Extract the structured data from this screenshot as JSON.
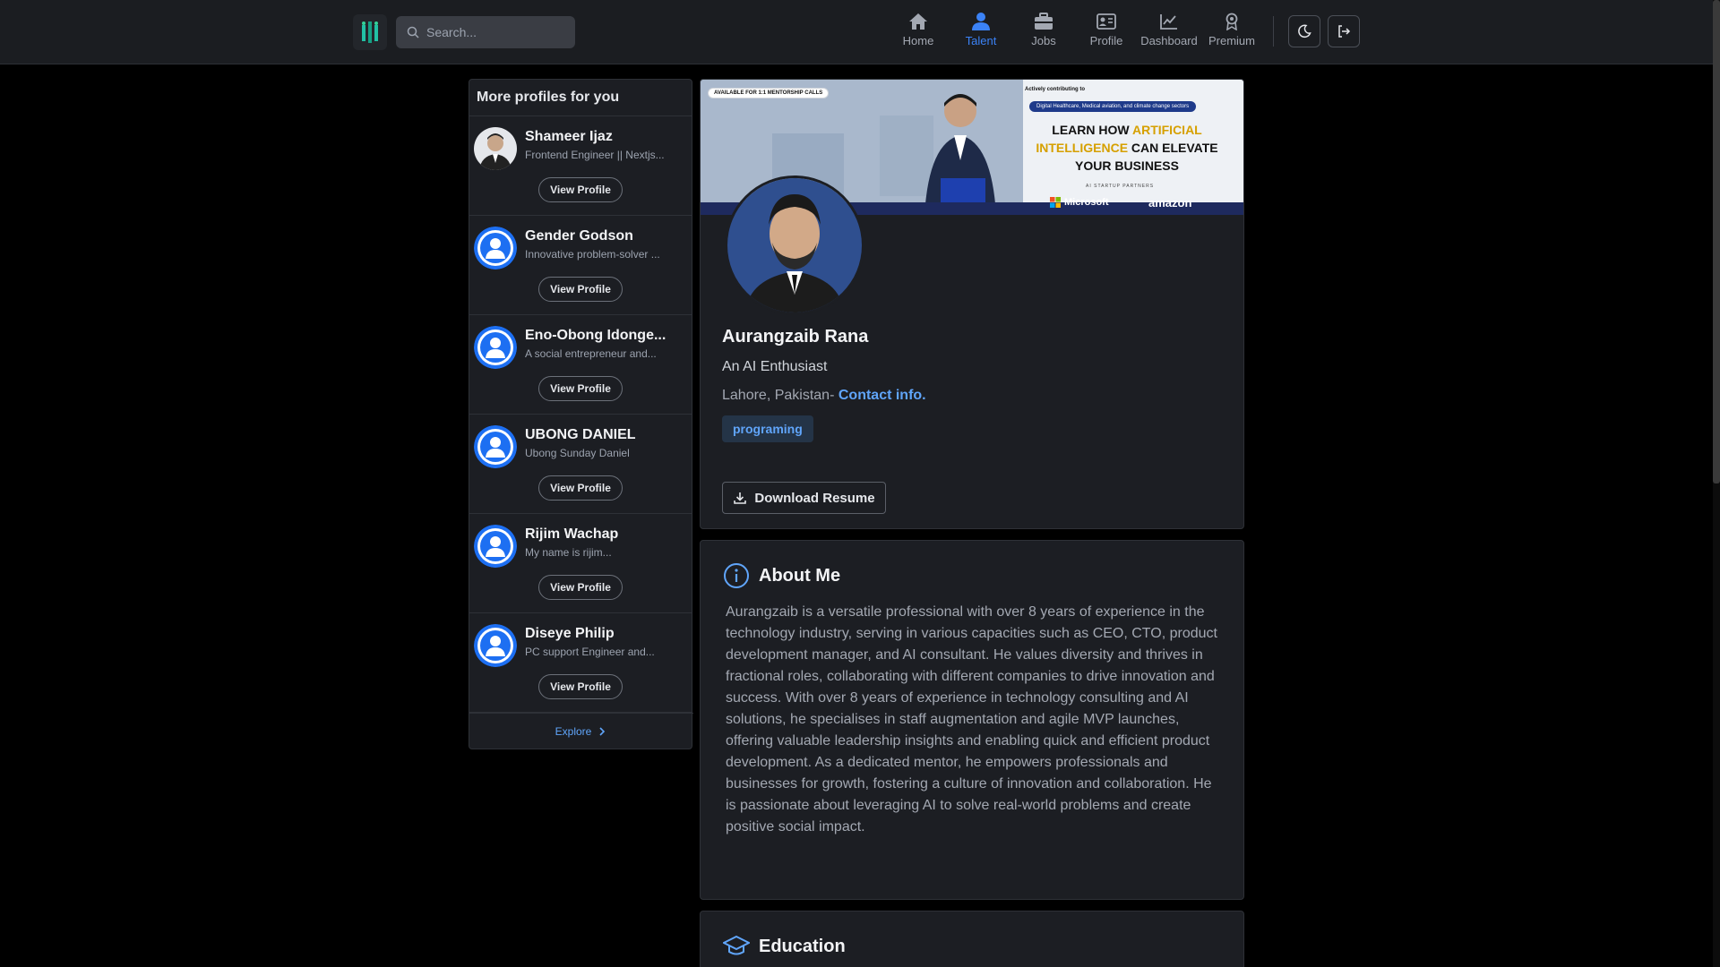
{
  "nav": {
    "search_placeholder": "Search...",
    "items": [
      {
        "label": "Home",
        "icon": "home-icon"
      },
      {
        "label": "Talent",
        "icon": "talent-icon",
        "active": true
      },
      {
        "label": "Jobs",
        "icon": "briefcase-icon"
      },
      {
        "label": "Profile",
        "icon": "id-card-icon"
      },
      {
        "label": "Dashboard",
        "icon": "chart-line-icon"
      },
      {
        "label": "Premium",
        "icon": "award-icon"
      }
    ],
    "accent_color": "#3b82f6"
  },
  "sidebar": {
    "title": "More profiles for you",
    "view_profile_label": "View Profile",
    "explore_label": "Explore",
    "profiles": [
      {
        "name": "Shameer Ijaz",
        "desc": "Frontend Engineer || Nextjs...",
        "avatar": "photo"
      },
      {
        "name": "Gender Godson",
        "desc": "Innovative problem-solver ...",
        "avatar": "default-user-icon"
      },
      {
        "name": "Eno-Obong Idonge...",
        "desc": "A social entrepreneur and...",
        "avatar": "default-user-icon"
      },
      {
        "name": "UBONG DANIEL",
        "desc": "Ubong Sunday Daniel",
        "avatar": "default-user-icon"
      },
      {
        "name": "Rijim Wachap",
        "desc": "My name is rijim...",
        "avatar": "default-user-icon"
      },
      {
        "name": "Diseye Philip",
        "desc": "PC support Engineer and...",
        "avatar": "default-user-icon"
      }
    ]
  },
  "banner": {
    "pill": "AVAILABLE FOR 1:1 MENTORSHIP CALLS",
    "active_text": "Actively contributing to",
    "sectors": "Digital Healthcare, Medical aviation, and climate change sectors",
    "headline_1": "LEARN HOW ",
    "headline_hl": "ARTIFICIAL INTELLIGENCE",
    "headline_2": " CAN ELEVATE YOUR BUSINESS",
    "partners": "AI STARTUP PARTNERS",
    "partner_1": "Microsoft",
    "partner_2": "amazon"
  },
  "profile": {
    "name": "Aurangzaib Rana",
    "headline": "An AI Enthusiast",
    "location": "Lahore, Pakistan-",
    "contact_label": "Contact info.",
    "tags": [
      "programing"
    ],
    "download_label": "Download Resume"
  },
  "about": {
    "title": "About Me",
    "text": "Aurangzaib is a versatile professional with over 8 years of experience in the technology industry, serving in various capacities such as CEO, CTO, product development manager, and AI consultant. He values diversity and thrives in fractional roles, collaborating with different companies to drive innovation and success. With over 8 years of experience in technology consulting and AI solutions, he specialises in staff augmentation and agile MVP launches, offering valuable leadership insights and enabling quick and efficient product development. As a dedicated mentor, he empowers professionals and businesses for growth, fostering a culture of innovation and collaboration. He is passionate about leveraging AI to solve real-world problems and create positive social impact."
  },
  "education": {
    "title": "Education"
  }
}
